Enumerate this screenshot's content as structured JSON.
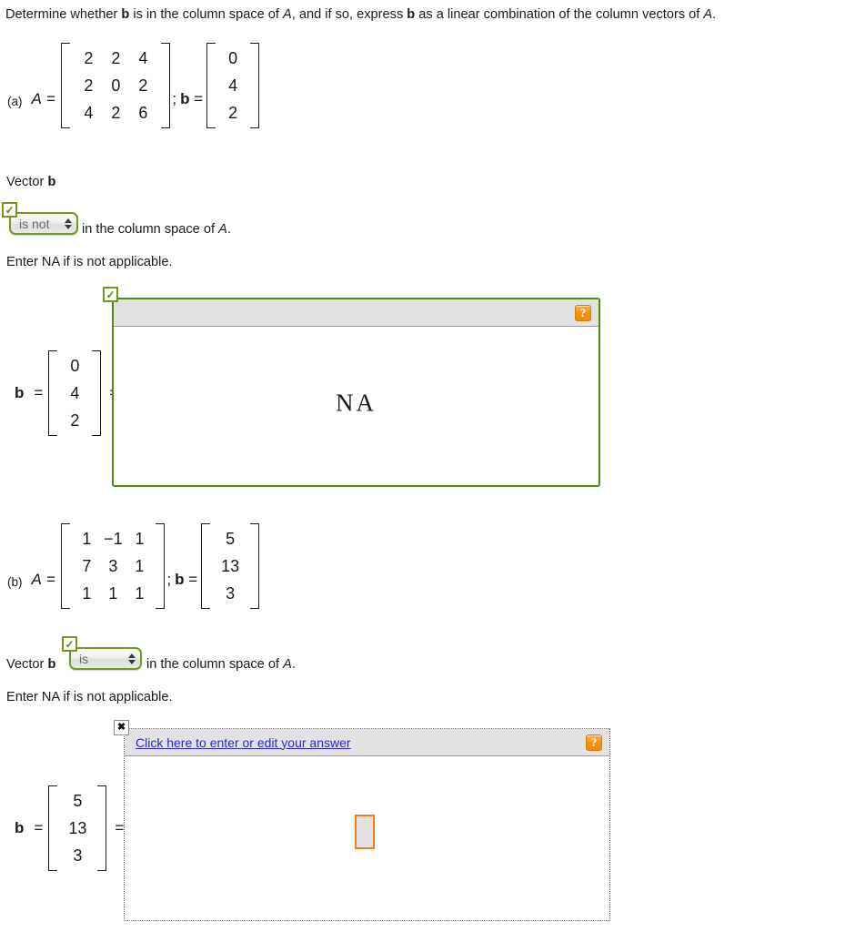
{
  "prompt": {
    "part1": "Determine whether ",
    "b1": "b",
    "part2": " is in the column space of ",
    "a1": "A",
    "part3": ", and if so, express ",
    "b2": "b",
    "part4": " as a linear combination of the column vectors of ",
    "a2": "A",
    "part5": "."
  },
  "problems": [
    {
      "label": "(a)",
      "a_symbol": "A =",
      "separator": ";",
      "b_symbol": "b =",
      "matrix_A": [
        [
          "2",
          "2",
          "4"
        ],
        [
          "2",
          "0",
          "2"
        ],
        [
          "4",
          "2",
          "6"
        ]
      ],
      "vector_b": [
        "0",
        "4",
        "2"
      ],
      "statement_prefix": "Vector",
      "statement_vector": "b",
      "statement_suffix": "in the column space of",
      "statement_matrix": "A",
      "statement_period": ".",
      "select_value": "is not",
      "select_options": [
        "is",
        "is not"
      ],
      "badge_status": "correct",
      "badge_glyph": "✓",
      "hint": "Enter NA if is not applicable.",
      "answer_lead": "b =",
      "answer_equals": "=",
      "answer_box": {
        "state": "correct",
        "toolbar_link": "",
        "help_label": "?",
        "content": "NA"
      }
    },
    {
      "label": "(b)",
      "a_symbol": "A =",
      "separator": ";",
      "b_symbol": "b =",
      "matrix_A": [
        [
          "1",
          "−1",
          "1"
        ],
        [
          "7",
          "3",
          "1"
        ],
        [
          "1",
          "1",
          "1"
        ]
      ],
      "vector_b": [
        "5",
        "13",
        "3"
      ],
      "statement_prefix": "Vector",
      "statement_vector": "b",
      "statement_suffix": "in the column space of",
      "statement_matrix": "A",
      "statement_period": ".",
      "select_value": "is",
      "select_options": [
        "is",
        "is not"
      ],
      "badge_status": "incorrect",
      "badge_glyph": "✖",
      "hint": "Enter NA if is not applicable.",
      "answer_lead": "b =",
      "answer_equals": "=",
      "answer_box": {
        "state": "blank",
        "toolbar_link": "Click here to enter or edit your answer",
        "help_label": "?",
        "content": ""
      }
    }
  ],
  "colors": {
    "correct_green": "#4f8a13",
    "select_border": "#6f9a1f",
    "help_orange": "#f59311",
    "link_blue": "#2a2ad0",
    "slot_orange": "#ef7f1a",
    "toolbar_gray": "#e2e2e2"
  }
}
